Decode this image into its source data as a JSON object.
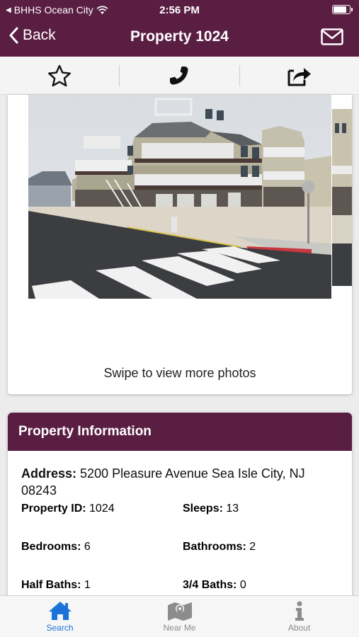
{
  "status_bar": {
    "carrier": "BHHS Ocean City",
    "time": "2:56 PM",
    "battery_level": 0.85
  },
  "nav": {
    "back_label": "Back",
    "title": "Property 1024",
    "mail_icon": "envelope-icon"
  },
  "toolbar": {
    "favorite_icon": "star-icon",
    "call_icon": "phone-icon",
    "share_icon": "share-icon"
  },
  "photos": {
    "swipe_hint": "Swipe to view more photos"
  },
  "property_info": {
    "header": "Property Information",
    "address_label": "Address:",
    "address_value": "5200 Pleasure Avenue Sea Isle City, NJ 08243",
    "id_label": "Property ID:",
    "id_value": "1024",
    "sleeps_label": "Sleeps:",
    "sleeps_value": "13",
    "bedrooms_label": "Bedrooms:",
    "bedrooms_value": "6",
    "bathrooms_label": "Bathrooms:",
    "bathrooms_value": "2",
    "half_baths_label": "Half Baths:",
    "half_baths_value": "1",
    "three_quarter_baths_label": "3/4 Baths:",
    "three_quarter_baths_value": "0"
  },
  "tabs": [
    {
      "label": "Search",
      "icon": "home-icon",
      "active": true
    },
    {
      "label": "Near Me",
      "icon": "map-icon",
      "active": false
    },
    {
      "label": "About",
      "icon": "info-icon",
      "active": false
    }
  ],
  "colors": {
    "brand": "#5a1e43",
    "active_tab": "#1a73d9",
    "inactive_tab": "#8c8c8c"
  }
}
